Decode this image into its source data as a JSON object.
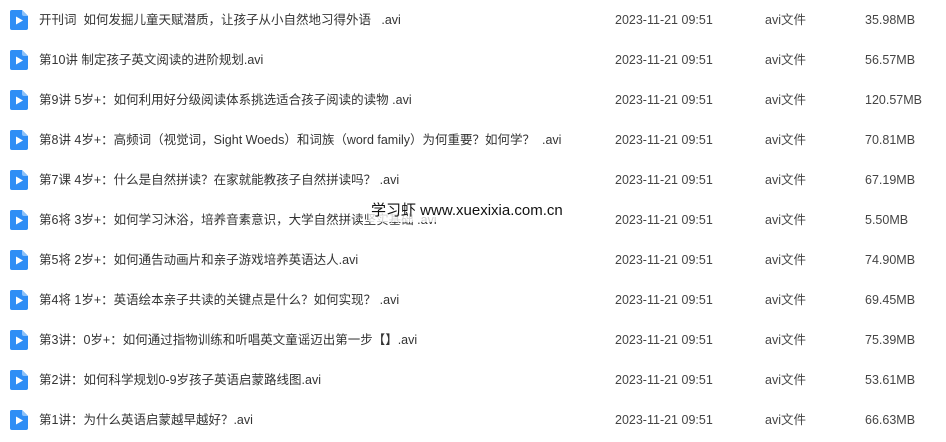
{
  "colors": {
    "icon_blue": "#2f8ef5",
    "text": "#333333"
  },
  "files": [
    {
      "icon": "video-file-icon",
      "name": "开刊词  如何发掘儿童天赋潜质，让孩子从小自然地习得外语   .avi",
      "date": "2023-11-21 09:51",
      "type": "avi文件",
      "size": "35.98MB"
    },
    {
      "icon": "video-file-icon",
      "name": "第10讲 制定孩子英文阅读的进阶规划.avi",
      "date": "2023-11-21 09:51",
      "type": "avi文件",
      "size": "56.57MB"
    },
    {
      "icon": "video-file-icon",
      "name": "第9讲 5岁+：如何利用好分级阅读体系挑选适合孩子阅读的读物 .avi",
      "date": "2023-11-21 09:51",
      "type": "avi文件",
      "size": "120.57MB"
    },
    {
      "icon": "video-file-icon",
      "name": "第8讲 4岁+：高频词（视觉词，Sight Woeds）和词族（word family）为何重要？如何学？  .avi",
      "date": "2023-11-21 09:51",
      "type": "avi文件",
      "size": "70.81MB"
    },
    {
      "icon": "video-file-icon",
      "name": "第7课 4岁+：什么是自然拼读？在家就能教孩子自然拼读吗？ .avi",
      "date": "2023-11-21 09:51",
      "type": "avi文件",
      "size": "67.19MB"
    },
    {
      "icon": "video-file-icon",
      "name": "第6将 3岁+：如何学习沐浴，培养音素意识，大学自然拼读坚实基础 .avi",
      "date": "2023-11-21 09:51",
      "type": "avi文件",
      "size": "5.50MB"
    },
    {
      "icon": "video-file-icon",
      "name": "第5将 2岁+：如何通告动画片和亲子游戏培养英语达人.avi",
      "date": "2023-11-21 09:51",
      "type": "avi文件",
      "size": "74.90MB"
    },
    {
      "icon": "video-file-icon",
      "name": "第4将 1岁+：英语绘本亲子共读的关键点是什么？如何实现？ .avi",
      "date": "2023-11-21 09:51",
      "type": "avi文件",
      "size": "69.45MB"
    },
    {
      "icon": "video-file-icon",
      "name": "第3讲：0岁+：如何通过指物训练和听唱英文童谣迈出第一步【】.avi",
      "date": "2023-11-21 09:51",
      "type": "avi文件",
      "size": "75.39MB"
    },
    {
      "icon": "video-file-icon",
      "name": "第2讲：如何科学规划0-9岁孩子英语启蒙路线图.avi",
      "date": "2023-11-21 09:51",
      "type": "avi文件",
      "size": "53.61MB"
    },
    {
      "icon": "video-file-icon",
      "name": "第1讲：为什么英语启蒙越早越好？.avi",
      "date": "2023-11-21 09:51",
      "type": "avi文件",
      "size": "66.63MB"
    }
  ],
  "watermark": {
    "text": "学习虾  www.xuexixia.com.cn"
  }
}
